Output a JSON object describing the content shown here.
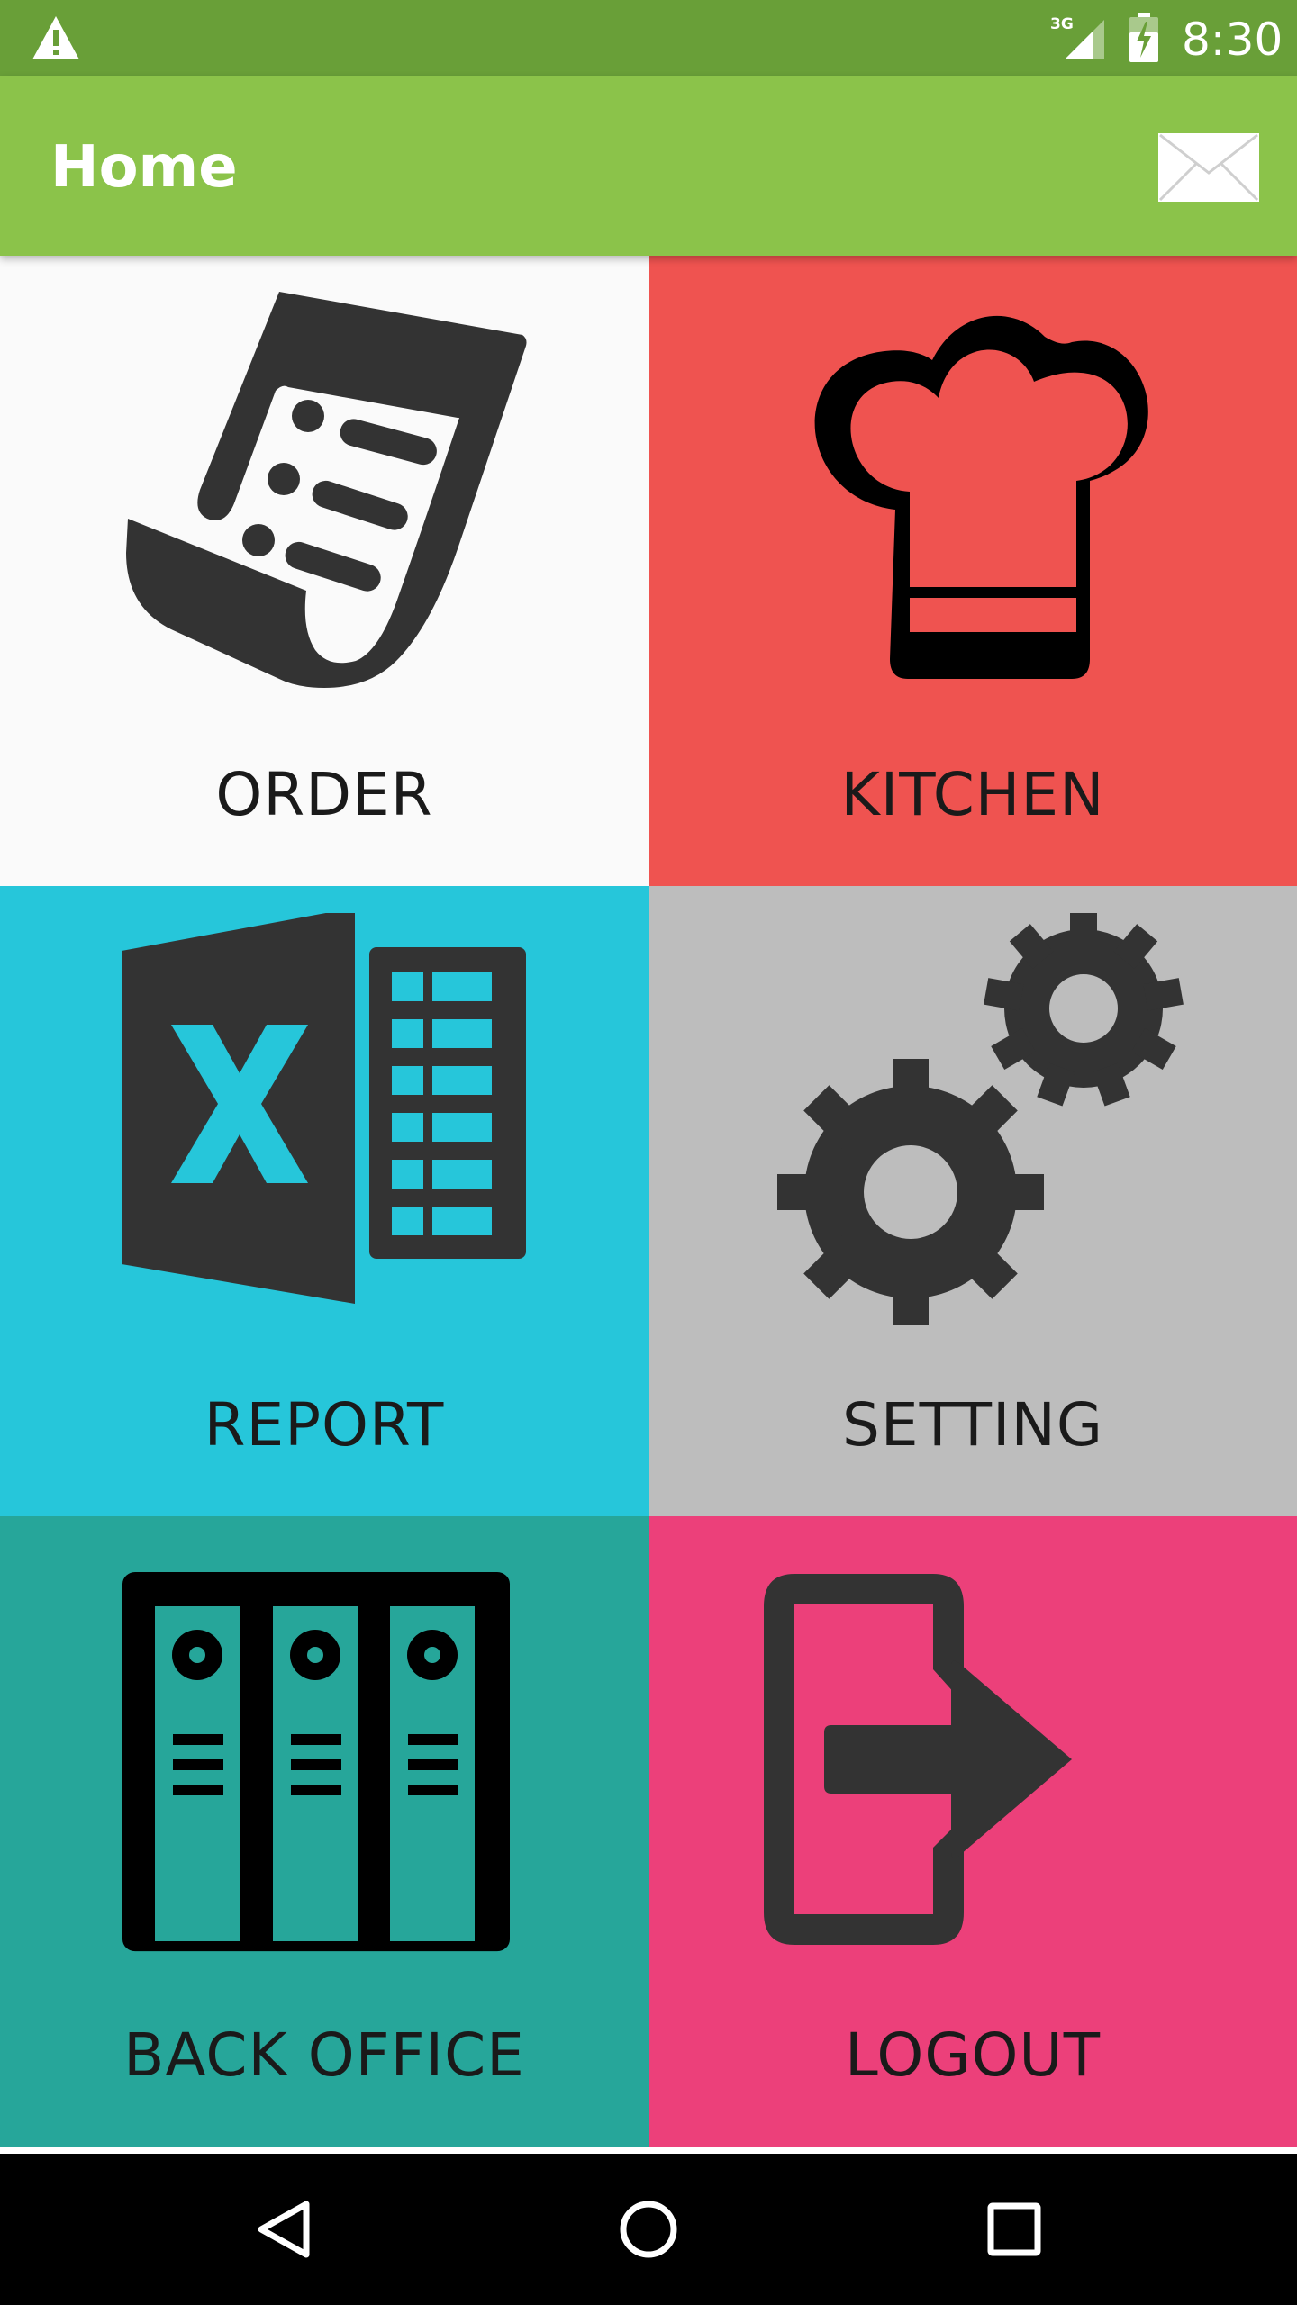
{
  "status_bar": {
    "network": "3G",
    "time": "8:30",
    "icons": [
      "warning-icon",
      "signal-icon",
      "battery-charging-icon"
    ]
  },
  "app_bar": {
    "title": "Home",
    "action_icon": "mail-icon"
  },
  "tiles": [
    {
      "label": "ORDER",
      "icon": "receipt-icon",
      "color": "#fafafa"
    },
    {
      "label": "KITCHEN",
      "icon": "chef-hat-icon",
      "color": "#ef5350"
    },
    {
      "label": "REPORT",
      "icon": "spreadsheet-icon",
      "color": "#26c6da"
    },
    {
      "label": "SETTING",
      "icon": "gears-icon",
      "color": "#bdbdbd"
    },
    {
      "label": "BACK OFFICE",
      "icon": "filing-cabinet-icon",
      "color": "#26a69a"
    },
    {
      "label": "LOGOUT",
      "icon": "logout-icon",
      "color": "#ec407a"
    }
  ],
  "nav_bar": {
    "buttons": [
      "back-icon",
      "home-icon",
      "recents-icon"
    ]
  },
  "colors": {
    "status_bar": "#699f38",
    "app_bar": "#8bc34a",
    "icon_dark": "#333333"
  }
}
